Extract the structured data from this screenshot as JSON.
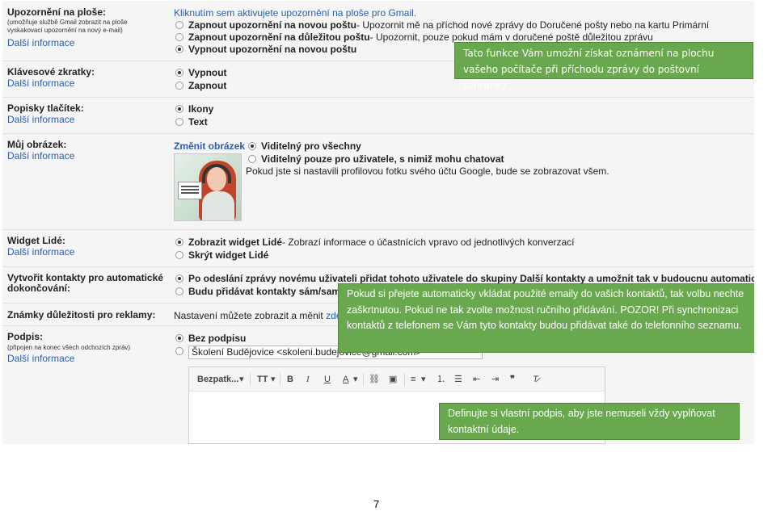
{
  "settings": {
    "notifications": {
      "label": "Upozornění na ploše:",
      "note": "(umožňuje službě Gmail zobrazit na ploše vyskakovací upozornění na nový e-mail)",
      "more": "Další informace",
      "activate_link": "Kliknutím sem aktivujete upozornění na ploše pro Gmail.",
      "options": [
        {
          "bold": "Zapnout upozornění na novou poštu",
          "rest": " - Upozornit mě na příchod nové zprávy do Doručené pošty nebo na kartu Primární",
          "selected": false
        },
        {
          "bold": "Zapnout upozornění na důležitou poštu",
          "rest": " - Upozornit, pouze pokud mám v doručené poště důležitou zprávu",
          "selected": false
        },
        {
          "bold": "Vypnout upozornění na novou poštu",
          "rest": "",
          "selected": true
        }
      ]
    },
    "shortcuts": {
      "label": "Klávesové zkratky:",
      "more": "Další informace",
      "options": [
        {
          "label": "Vypnout",
          "selected": true
        },
        {
          "label": "Zapnout",
          "selected": false
        }
      ]
    },
    "button_labels": {
      "label": "Popisky tlačítek:",
      "more": "Další informace",
      "options": [
        {
          "label": "Ikony",
          "selected": true
        },
        {
          "label": "Text",
          "selected": false
        }
      ]
    },
    "picture": {
      "label": "Můj obrázek:",
      "more": "Další informace",
      "change_link": "Změnit obrázek",
      "options": [
        {
          "label": "Viditelný pro všechny",
          "selected": true
        },
        {
          "label": "Viditelný pouze pro uživatele, s nimiž mohu chatovat",
          "selected": false
        }
      ],
      "note": "Pokud jste si nastavili profilovou fotku svého účtu Google, bude se zobrazovat všem."
    },
    "people_widget": {
      "label": "Widget Lidé:",
      "more": "Další informace",
      "options": [
        {
          "bold": "Zobrazit widget Lidé",
          "rest": " - Zobrazí informace o účastnících vpravo od jednotlivých konverzací",
          "selected": true
        },
        {
          "bold": "Skrýt widget Lidé",
          "rest": "",
          "selected": false
        }
      ]
    },
    "auto_contacts": {
      "label_line1": "Vytvořit kontakty pro automatické",
      "label_line2": "dokončování:",
      "options": [
        {
          "label": "Po odeslání zprávy novému uživateli přidat tohoto uživatele do skupiny Další kontakty a umožnit tak v budoucnu automatické dokon",
          "selected": true
        },
        {
          "label": "Budu přidávat kontakty sám/sama",
          "selected": false
        }
      ]
    },
    "ads_importance": {
      "label": "Známky důležitosti pro reklamy:",
      "text": "Nastavení můžete zobrazit a měnit ",
      "link": "zde."
    },
    "signature": {
      "label": "Podpis:",
      "note": "(připojen na konec všech odchozích zpráv)",
      "more": "Další informace",
      "option_none": "Bez podpisu",
      "none_selected": true,
      "field_value": "Školení Budějovice <skoleni.budejovice@gmail.com>",
      "editor": {
        "font": "Bezpatk...",
        "size_icon": "TT",
        "bold": "B",
        "italic": "I",
        "underline": "U",
        "text_color": "A"
      }
    }
  },
  "callouts": {
    "desktop_notifications": "Tato funkce Vám umožní získat oznámení na plochu vašeho počítače při příchodu zprávy do poštovní schránky",
    "auto_contacts": "Pokud si přejete automaticky vkládat použité emaily do vašich kontaktů, tak volbu nechte zaškrtnutou. Pokud ne tak zvolte možnost ručního přidávání. POZOR! Při synchronizaci kontaktů z telefonem se Vám tyto kontakty budou přidávat také do telefonního seznamu.",
    "signature": "Definujte si vlastní podpis, aby jste nemuseli vždy vyplňovat kontaktní údaje."
  },
  "page_number": "7",
  "colors": {
    "link": "#2a5db0",
    "callout_bg": "#69a84f",
    "callout_text": "#ffffff"
  }
}
